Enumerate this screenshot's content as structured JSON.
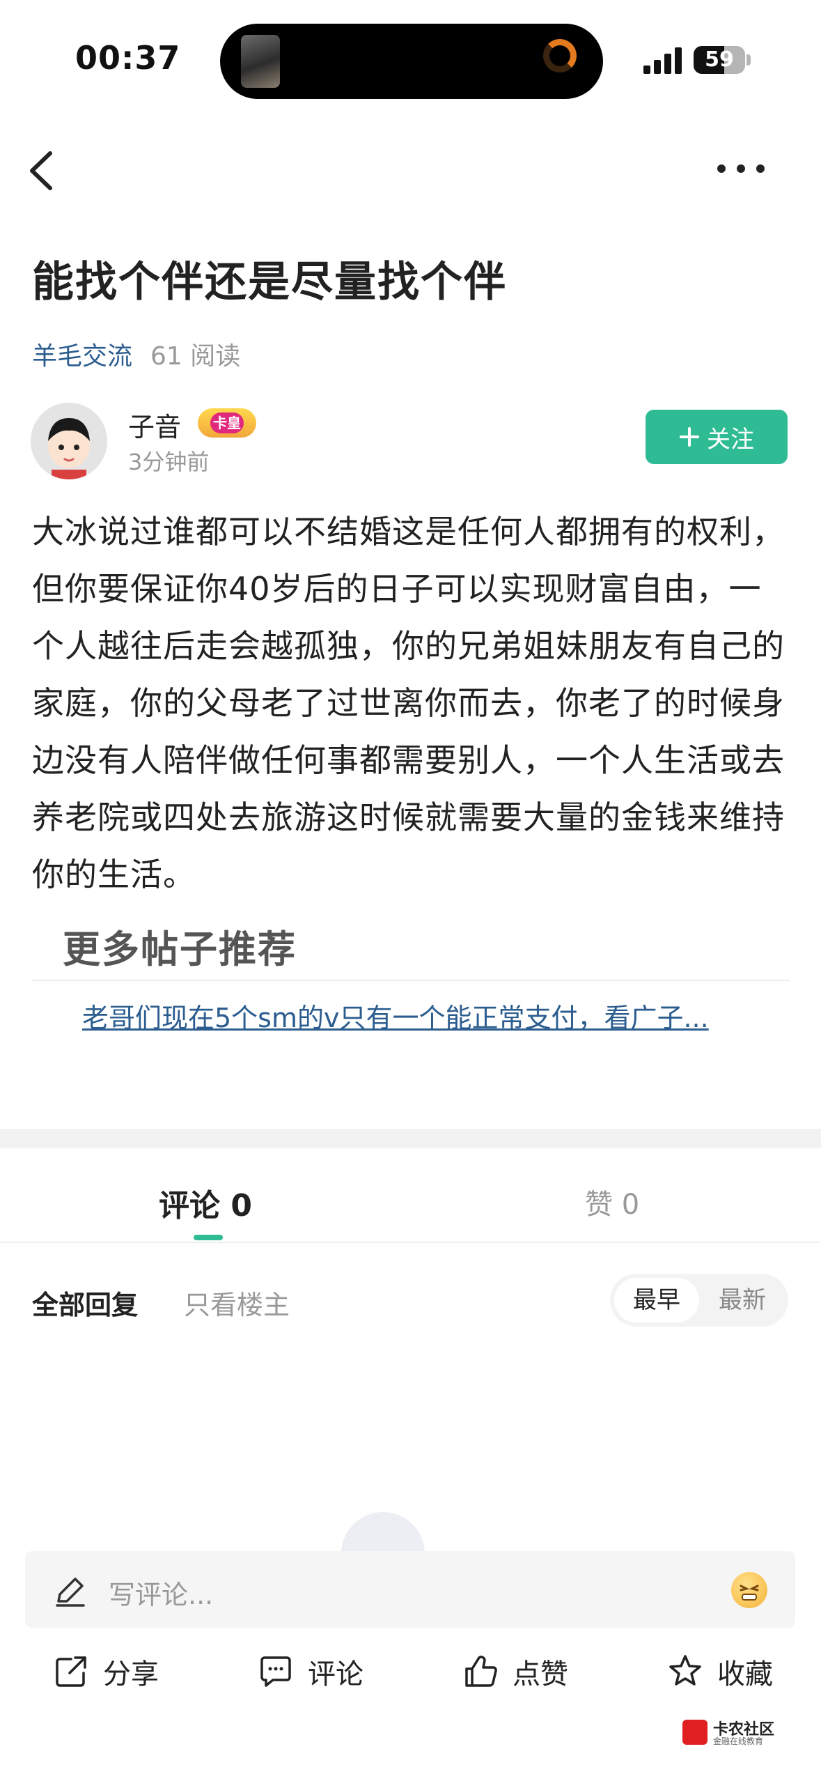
{
  "status_bar": {
    "time": "00:37",
    "battery": "59",
    "battery_level": 0.59
  },
  "post": {
    "title": "能找个伴还是尽量找个伴",
    "category": "羊毛交流",
    "reads": "61 阅读",
    "author": {
      "name": "子音",
      "badge": "卡皇",
      "time": "3分钟前"
    },
    "follow_label": "关注",
    "body": "大冰说过谁都可以不结婚这是任何人都拥有的权利，但你要保证你40岁后的日子可以实现财富自由，一个人越往后走会越孤独，你的兄弟姐妹朋友有自己的家庭，你的父母老了过世离你而去，你老了的时候身边没有人陪伴做任何事都需要别人，一个人生活或去养老院或四处去旅游这时候就需要大量的金钱来维持你的生活。"
  },
  "recommend": {
    "title": "更多帖子推荐",
    "link": "老哥们现在5个sm的v只有一个能正常支付，看广子..."
  },
  "tabs": {
    "comments": "评论 0",
    "likes": "赞 0"
  },
  "filters": {
    "all": "全部回复",
    "owner_only": "只看楼主",
    "earliest": "最早",
    "newest": "最新"
  },
  "comment_input": {
    "placeholder": "写评论..."
  },
  "actions": {
    "share": "分享",
    "comment": "评论",
    "like": "点赞",
    "favorite": "收藏"
  },
  "watermark": {
    "name": "卡农社区",
    "sub": "金融在线教育"
  },
  "colors": {
    "accent": "#2fbc95",
    "link": "#2c5d8f",
    "muted": "#999999"
  }
}
